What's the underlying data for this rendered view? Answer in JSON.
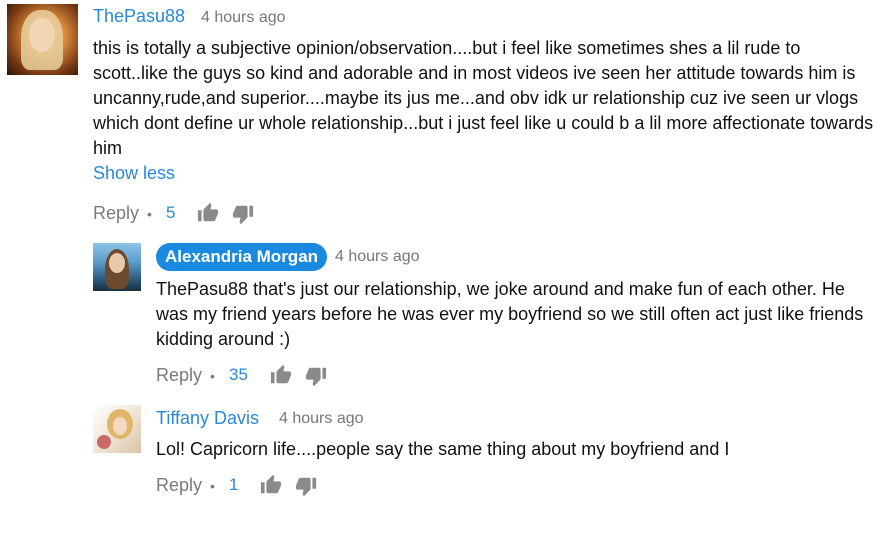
{
  "comments": [
    {
      "author": "ThePasu88",
      "time": "4 hours ago",
      "text": "this is totally a subjective opinion/observation....but i feel like sometimes shes a lil rude to scott..like the guys so kind and adorable and in most videos ive seen her attitude towards him is uncanny,rude,and superior....maybe its jus me...and obv idk ur relationship cuz ive seen ur vlogs which dont define ur whole relationship...but i just feel like u could b a lil more affectionate towards him",
      "show_less": "Show less",
      "reply_label": "Reply",
      "likes": "5"
    }
  ],
  "replies": [
    {
      "author": "Alexandria Morgan",
      "time": "4 hours ago",
      "text": "ThePasu88 that's just our relationship, we joke around and make fun of each other. He was my friend years before he was ever my boyfriend so we still often act just like friends kidding around :)",
      "reply_label": "Reply",
      "likes": "35"
    },
    {
      "author": "Tiffany Davis",
      "time": "4 hours ago",
      "text": "Lol! Capricorn life....people say the same thing about my boyfriend and I",
      "reply_label": "Reply",
      "likes": "1"
    }
  ],
  "separator": "•",
  "icons": {
    "like": "thumbs-up-icon",
    "dislike": "thumbs-down-icon"
  },
  "colors": {
    "link": "#2a88d8",
    "creator_badge": "#1a8ae0",
    "muted": "#7a7a7a"
  }
}
